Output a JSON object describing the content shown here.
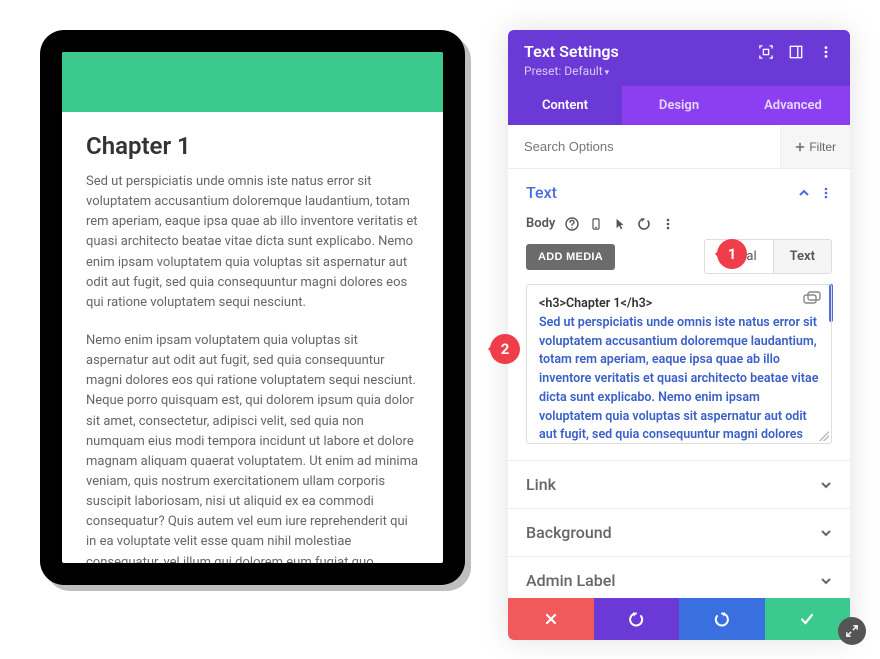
{
  "preview": {
    "chapter_title": "Chapter 1",
    "para1": "Sed ut perspiciatis unde omnis iste natus error sit voluptatem accusantium doloremque laudantium, totam rem aperiam, eaque ipsa quae ab illo inventore veritatis et quasi architecto beatae vitae dicta sunt explicabo. Nemo enim ipsam voluptatem quia voluptas sit aspernatur aut odit aut fugit, sed quia consequuntur magni dolores eos qui ratione voluptatem sequi nesciunt.",
    "para2": "Nemo enim ipsam voluptatem quia voluptas sit aspernatur aut odit aut fugit, sed quia consequuntur magni dolores eos qui ratione voluptatem sequi nesciunt. Neque porro quisquam est, qui dolorem ipsum quia dolor sit amet, consectetur, adipisci velit, sed quia non numquam eius modi tempora incidunt ut labore et dolore magnam aliquam quaerat voluptatem. Ut enim ad minima veniam, quis nostrum exercitationem ullam corporis suscipit laboriosam, nisi ut aliquid ex ea commodi consequatur? Quis autem vel eum iure reprehenderit qui in ea voluptate velit esse quam nihil molestiae consequatur, vel illum qui dolorem eum fugiat quo voluptas nulla pariatur?"
  },
  "panel": {
    "title": "Text Settings",
    "preset_label": "Preset: Default",
    "tabs": {
      "content": "Content",
      "design": "Design",
      "advanced": "Advanced"
    },
    "search_placeholder": "Search Options",
    "filter_label": "Filter",
    "sections": {
      "text": "Text",
      "link": "Link",
      "background": "Background",
      "admin_label": "Admin Label"
    },
    "body_label": "Body",
    "add_media": "ADD MEDIA",
    "editor_tabs": {
      "visual": "Visual",
      "text": "Text"
    },
    "code_html": "<h3>Chapter 1</h3>",
    "code_body": "Sed ut perspiciatis unde omnis iste natus error sit voluptatem accusantium doloremque laudantium, totam rem aperiam, eaque ipsa quae ab illo inventore veritatis et quasi architecto beatae vitae dicta sunt explicabo. Nemo enim ipsam voluptatem quia voluptas sit aspernatur aut odit aut fugit, sed quia consequuntur magni dolores eos qui ratione voluptatem sequi nesciunt."
  },
  "callouts": {
    "one": "1",
    "two": "2"
  }
}
